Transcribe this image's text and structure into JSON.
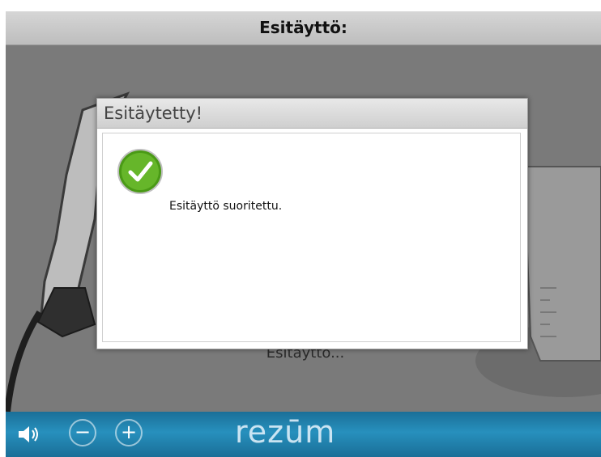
{
  "header": {
    "title": "Esitäyttö:"
  },
  "background": {
    "status_text": "Esitäyttö..."
  },
  "dialog": {
    "title": "Esitäytetty!",
    "message": "Esitäyttö suoritettu."
  },
  "footer": {
    "minus_label": "−",
    "plus_label": "+",
    "brand": "rezūm"
  },
  "colors": {
    "footer_blue": "#2790bd",
    "check_green": "#5aac1e",
    "title_bg": "#c8c8c8"
  },
  "icons": [
    "volume-icon",
    "success-check-icon"
  ]
}
